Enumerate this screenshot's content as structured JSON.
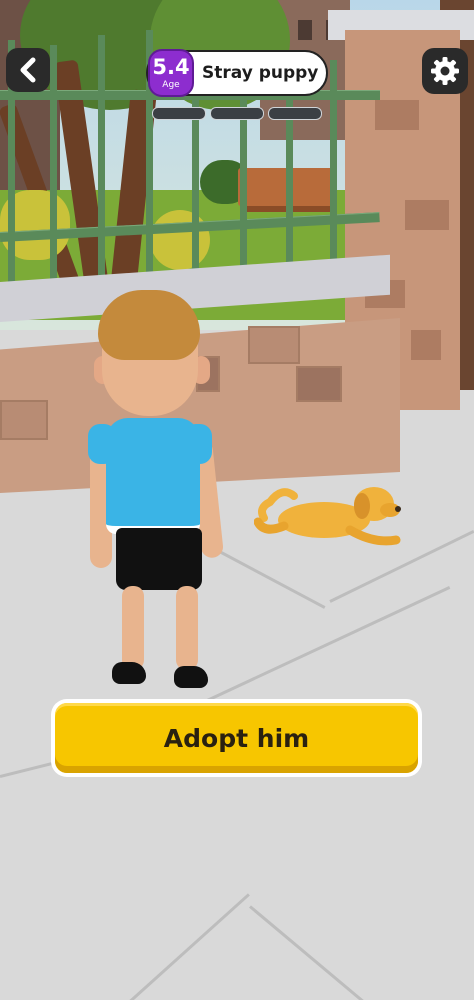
{
  "hud": {
    "back_icon": "chevron-left-icon",
    "settings_icon": "gear-icon",
    "age_value": "5.4",
    "age_label": "Age",
    "title": "Stray puppy",
    "progress_segments": 3
  },
  "action": {
    "adopt_label": "Adopt him"
  },
  "colors": {
    "age_badge": "#8d2dcf",
    "adopt_button": "#f7c600",
    "shirt": "#3ab4e6",
    "puppy": "#f0b23c"
  }
}
